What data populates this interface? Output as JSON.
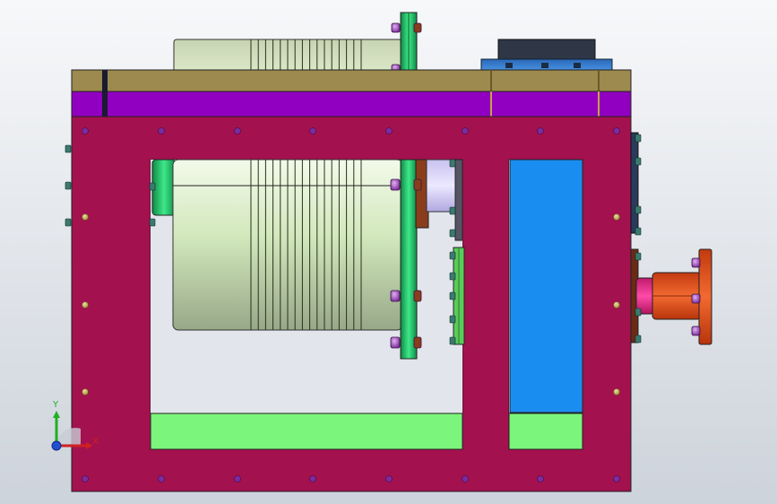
{
  "triad": {
    "x_label": "X",
    "y_label": "Y"
  },
  "colors": {
    "background_top": "#f7f8fa",
    "background_bottom": "#cdd3db",
    "frame": "#a3114f",
    "top_plate": "#9c8a4e",
    "purple_band": "#9100c0",
    "green_panel": "#7bf57b",
    "blue_panel": "#1a8ef0",
    "drum": "#d6ecc0",
    "flange_green": "#22cc66",
    "flange_brown": "#8a3d1c",
    "orange": "#e8501c",
    "magenta": "#f0288c",
    "motor_blue": "#3c86d8",
    "dark": "#303848",
    "bolt": "#9b3fb5",
    "axis_x": "#d02020",
    "axis_y": "#20b020",
    "axis_z": "#2050d0"
  }
}
